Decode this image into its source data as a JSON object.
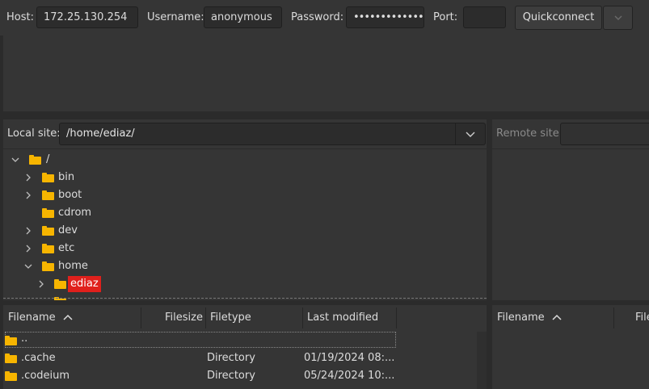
{
  "quickconnect": {
    "host_label": "Host:",
    "host_value": "172.25.130.254",
    "username_label": "Username:",
    "username_value": "anonymous",
    "password_label": "Password:",
    "password_value": "•••••••••••••••",
    "port_label": "Port:",
    "port_value": "",
    "connect_label": "Quickconnect"
  },
  "local_site": {
    "label": "Local site:",
    "path": "/home/ediaz/"
  },
  "remote_site": {
    "label": "Remote site:"
  },
  "local_tree": [
    {
      "label": "/",
      "expanded": true
    },
    {
      "label": "bin",
      "expanded": false
    },
    {
      "label": "boot",
      "expanded": false
    },
    {
      "label": "cdrom"
    },
    {
      "label": "dev",
      "expanded": false
    },
    {
      "label": "etc",
      "expanded": false
    },
    {
      "label": "home",
      "expanded": true
    },
    {
      "label": "ediaz",
      "expanded": false,
      "selected": true
    }
  ],
  "local_list": {
    "columns": [
      "Filename",
      "Filesize",
      "Filetype",
      "Last modified"
    ],
    "rows": [
      {
        "name": "..",
        "size": "",
        "type": "",
        "modified": ""
      },
      {
        "name": ".cache",
        "size": "",
        "type": "Directory",
        "modified": "01/19/2024 08:..."
      },
      {
        "name": ".codeium",
        "size": "",
        "type": "Directory",
        "modified": "05/24/2024 10:..."
      }
    ]
  },
  "remote_list": {
    "columns": [
      "Filename",
      "File"
    ]
  },
  "colors": {
    "folder": "#f7b500",
    "selection": "#e0201c"
  }
}
